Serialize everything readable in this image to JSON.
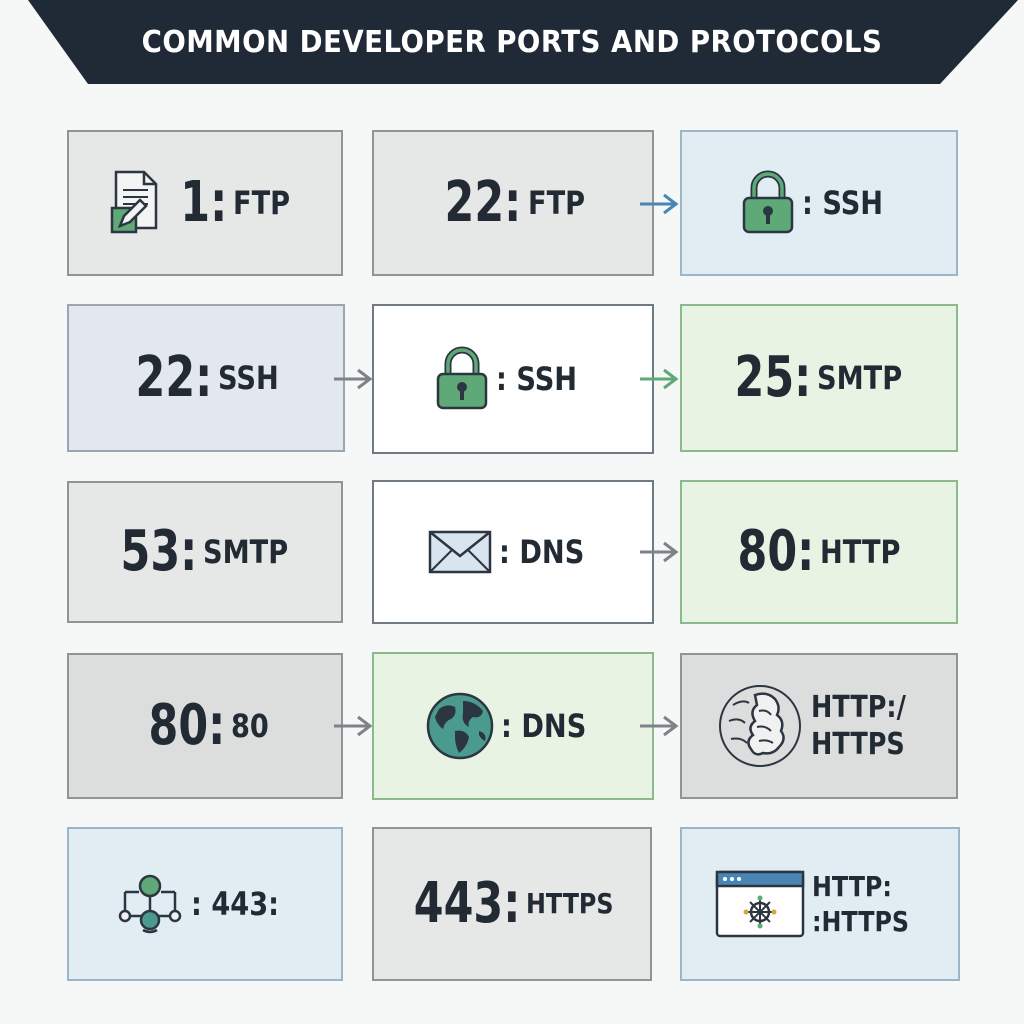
{
  "title": "COMMON DEVELOPER PORTS AND PROTOCOLS",
  "colors": {
    "banner": "#1f2a36",
    "accent_green": "#3f8f5a",
    "accent_blue": "#4a86b5",
    "text": "#222b33"
  },
  "cards": [
    {
      "num": "1:",
      "proto": "FTP",
      "icon": "document-edit-icon"
    },
    {
      "num": "22:",
      "proto": "FTP"
    },
    {
      "proto": ": SSH",
      "icon": "padlock-icon"
    },
    {
      "num": "22:",
      "proto": "SSH"
    },
    {
      "proto": ": SSH",
      "icon": "padlock-icon"
    },
    {
      "num": "25:",
      "proto": "SMTP"
    },
    {
      "num": "53:",
      "proto": "SMTP"
    },
    {
      "proto": ": DNS",
      "icon": "envelope-icon"
    },
    {
      "num": "80:",
      "proto": "HTTP"
    },
    {
      "num": "80:",
      "proto": "80"
    },
    {
      "proto": ": DNS",
      "icon": "globe-icon"
    },
    {
      "line1": "HTTP:/",
      "line2": "HTTPS",
      "icon": "globe-hand-icon"
    },
    {
      "proto": ": 443:",
      "icon": "network-nodes-icon"
    },
    {
      "num": "443:",
      "proto": "HTTPS"
    },
    {
      "line1": "HTTP:",
      "line2": ":HTTPS",
      "icon": "browser-window-icon"
    }
  ]
}
